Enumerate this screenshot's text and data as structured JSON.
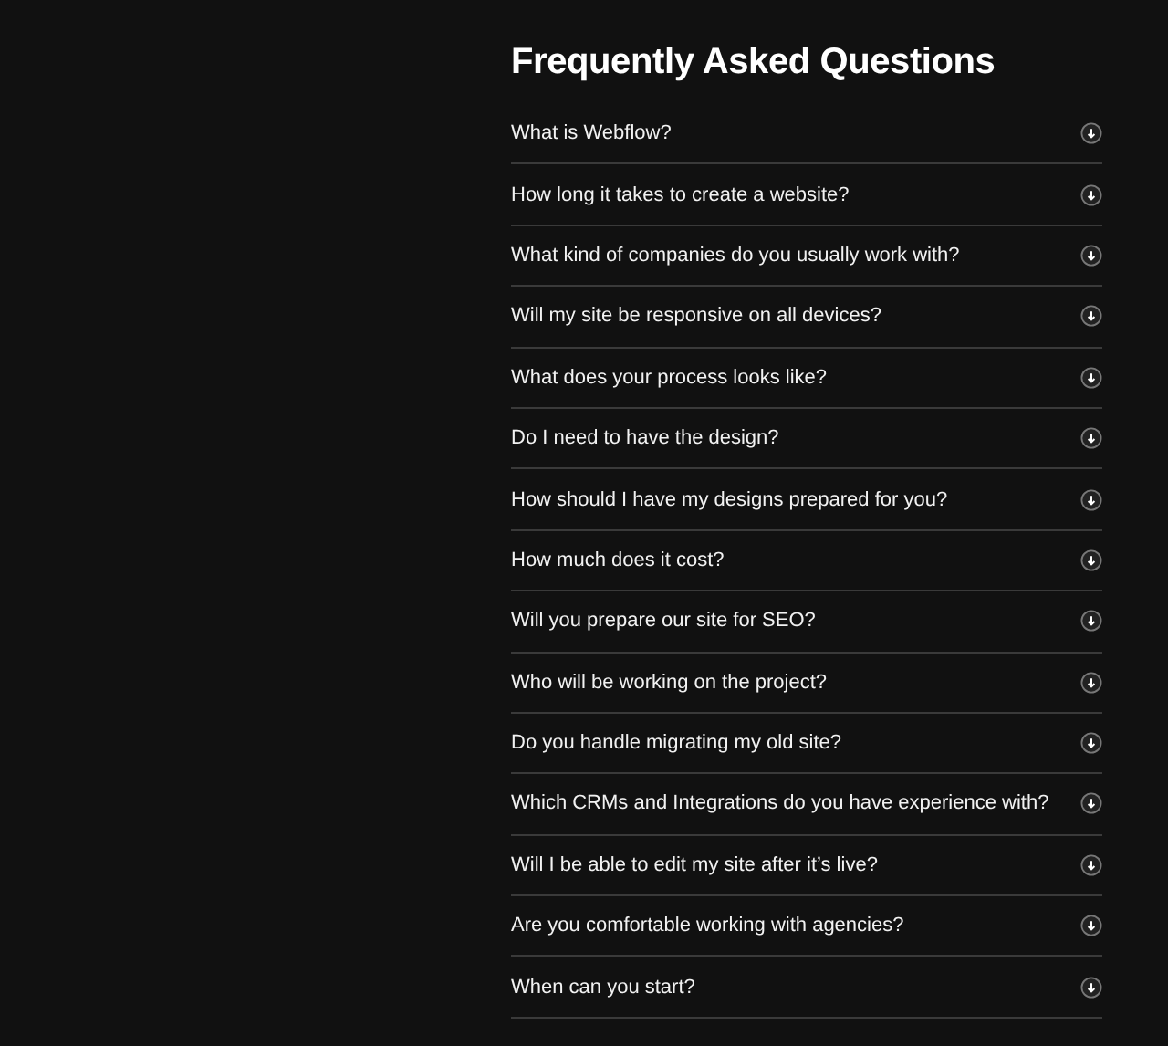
{
  "title": "Frequently Asked Questions",
  "questions": [
    {
      "text": "What is Webflow?",
      "expanded": false
    },
    {
      "text": "How long it takes to create a website?",
      "expanded": false
    },
    {
      "text": "What kind of companies do you usually work with?",
      "expanded": false
    },
    {
      "text": "Will my site be responsive on all devices?",
      "expanded": false
    },
    {
      "text": "What does your process looks like?",
      "expanded": false
    },
    {
      "text": "Do I need to have the design?",
      "expanded": false
    },
    {
      "text": "How should I have my designs prepared for you?",
      "expanded": false
    },
    {
      "text": "How much does it cost?",
      "expanded": false
    },
    {
      "text": "Will you prepare our site for SEO?",
      "expanded": false
    },
    {
      "text": "Who will be working on the project?",
      "expanded": false
    },
    {
      "text": "Do you handle migrating my old site?",
      "expanded": false
    },
    {
      "text": "Which CRMs and Integrations do you have experience with?",
      "expanded": false
    },
    {
      "text": "Will I be able to edit my site after it’s live?",
      "expanded": false
    },
    {
      "text": "Are you comfortable working with agencies?",
      "expanded": false
    },
    {
      "text": "When can you start?",
      "expanded": false
    }
  ]
}
